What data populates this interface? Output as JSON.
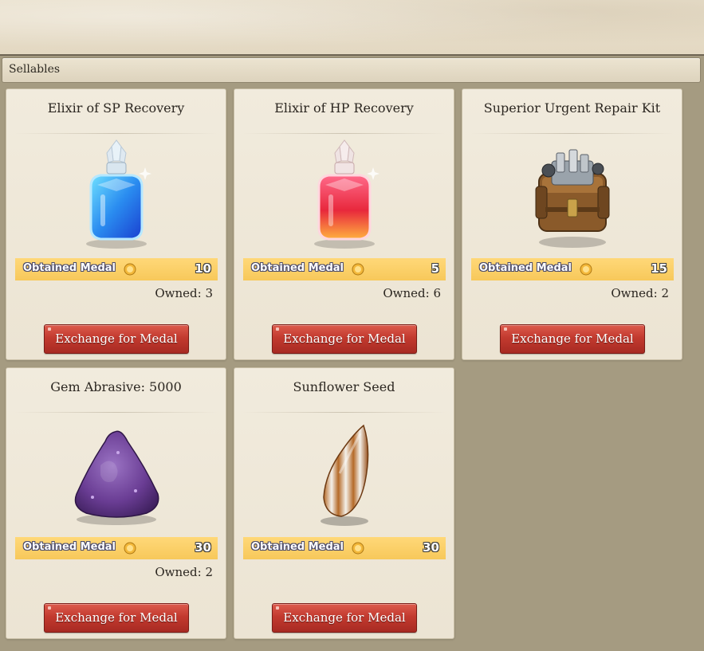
{
  "section": {
    "title": "Sellables"
  },
  "items": [
    {
      "name": "Elixir of SP Recovery",
      "medal_label": "Obtained Medal",
      "medal_value": "10",
      "owned": "Owned: 3",
      "button": "Exchange for Medal",
      "icon": "blue-elixir-bottle-icon"
    },
    {
      "name": "Elixir of HP Recovery",
      "medal_label": "Obtained Medal",
      "medal_value": "5",
      "owned": "Owned: 6",
      "button": "Exchange for Medal",
      "icon": "red-elixir-bottle-icon"
    },
    {
      "name": "Superior Urgent Repair Kit",
      "medal_label": "Obtained Medal",
      "medal_value": "15",
      "owned": "Owned: 2",
      "button": "Exchange for Medal",
      "icon": "repair-kit-icon"
    },
    {
      "name": "Gem Abrasive: 5000",
      "medal_label": "Obtained Medal",
      "medal_value": "30",
      "owned": "Owned: 2",
      "button": "Exchange for Medal",
      "icon": "purple-abrasive-pile-icon"
    },
    {
      "name": "Sunflower Seed",
      "medal_label": "Obtained Medal",
      "medal_value": "30",
      "owned": "",
      "button": "Exchange for Medal",
      "icon": "sunflower-seed-icon"
    }
  ],
  "colors": {
    "medal_bar": "#f7c85a",
    "button_red": "#c23a2f",
    "panel_bg": "#a59b81",
    "card_bg": "#efe8d9"
  }
}
